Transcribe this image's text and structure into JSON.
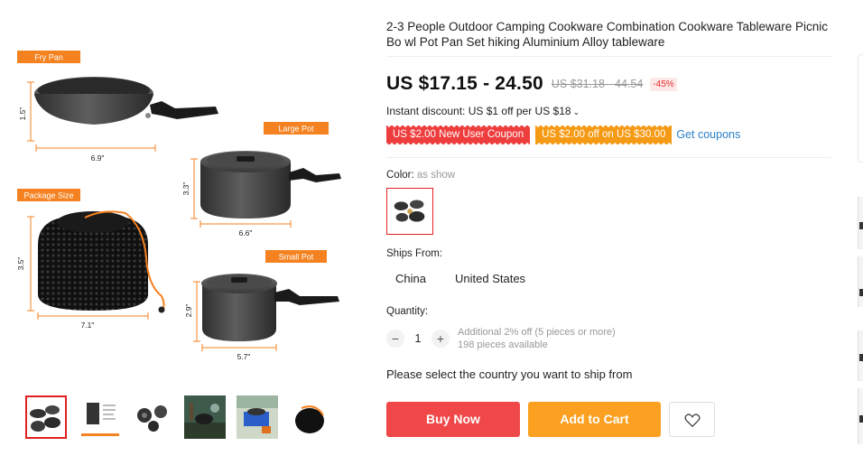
{
  "gallery": {
    "main_image": {
      "labels": {
        "fry_pan": "Fry Pan",
        "large_pot": "Large Pot",
        "package_size": "Package Size",
        "small_pot": "Small Pot"
      },
      "dimensions": {
        "fry_pan_height": "1.5\"",
        "fry_pan_width": "6.9\"",
        "large_pot_height": "3.3\"",
        "large_pot_width": "6.6\"",
        "package_height": "3.5\"",
        "package_width": "7.1\"",
        "small_pot_height": "2.9\"",
        "small_pot_width": "5.7\""
      }
    },
    "thumbnails": [
      "cookware-set",
      "size-chart",
      "pots-and-pans",
      "campfire-scene",
      "camping-stove-scene",
      "mesh-bag"
    ],
    "active_thumbnail": 0
  },
  "product": {
    "title": "2-3 People Outdoor Camping Cookware Combination Cookware Tableware Picnic Bo wl Pot Pan Set hiking Aluminium Alloy tableware",
    "price": "US $17.15 - 24.50",
    "original_price": "US $31.18 - 44.54",
    "discount": "-45%",
    "instant_discount": "Instant discount: US $1 off per US $18",
    "coupons": [
      "US $2.00 New User Coupon",
      "US $2.00 off on US $30.00"
    ],
    "get_coupons": "Get coupons",
    "color_label": "Color:",
    "color_value": "as show",
    "ships_from_label": "Ships From:",
    "ships_from_options": [
      "China",
      "United States"
    ],
    "quantity_label": "Quantity:",
    "quantity": "1",
    "quantity_decrement": "−",
    "quantity_increment": "+",
    "bulk_note": "Additional 2% off (5 pieces or more)",
    "available_note": "198 pieces available",
    "ship_message": "Please select the country you want to ship from",
    "buy_now": "Buy Now",
    "add_to_cart": "Add to Cart"
  },
  "colors": {
    "accent_red": "#f04848",
    "accent_orange": "#fba020",
    "coupon_red": "#ee3d3d",
    "coupon_orange": "#f59a14",
    "link_blue": "#2a7fc5",
    "label_orange": "#f58220"
  }
}
